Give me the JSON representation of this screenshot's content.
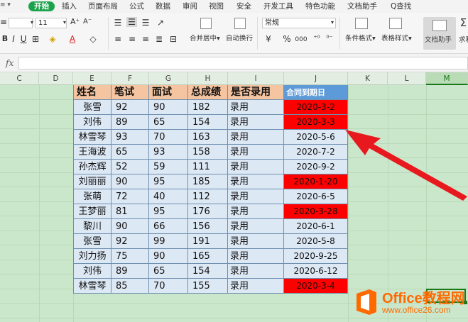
{
  "menu": {
    "dropdown": "≡ ▾",
    "items": [
      "开始",
      "插入",
      "页面布局",
      "公式",
      "数据",
      "审阅",
      "视图",
      "安全",
      "开发工具",
      "特色功能",
      "文档助手",
      "Q查找"
    ],
    "active_index": 0
  },
  "toolbar": {
    "font_size": "11",
    "bold": "B",
    "italic": "I",
    "underline": "U",
    "merge_label": "合并居中▾",
    "wrap_label": "自动换行",
    "number_format": "常规",
    "currency": "¥",
    "percent": "%",
    "thousands": "000",
    "cond_format_label": "条件格式▾",
    "table_style_label": "表格样式▾",
    "doc_helper_label": "文档助手",
    "sum_label": "求和"
  },
  "formula_bar": {
    "fx": "fx",
    "value": ""
  },
  "columns": [
    "C",
    "D",
    "E",
    "F",
    "G",
    "H",
    "I",
    "J",
    "K",
    "L",
    "M"
  ],
  "selected_column": "M",
  "table": {
    "headers": [
      "姓名",
      "笔试",
      "面试",
      "总成绩",
      "是否录用",
      "合同到期日"
    ],
    "rows": [
      {
        "name": "张雪",
        "written": "92",
        "interview": "90",
        "total": "182",
        "hired": "录用",
        "date": "2020-3-2",
        "expired": true
      },
      {
        "name": "刘伟",
        "written": "89",
        "interview": "65",
        "total": "154",
        "hired": "录用",
        "date": "2020-3-3",
        "expired": true
      },
      {
        "name": "林雪琴",
        "written": "93",
        "interview": "70",
        "total": "163",
        "hired": "录用",
        "date": "2020-5-6",
        "expired": false
      },
      {
        "name": "王海波",
        "written": "65",
        "interview": "93",
        "total": "158",
        "hired": "录用",
        "date": "2020-7-2",
        "expired": false
      },
      {
        "name": "孙杰辉",
        "written": "52",
        "interview": "59",
        "total": "111",
        "hired": "录用",
        "date": "2020-9-2",
        "expired": false
      },
      {
        "name": "刘丽丽",
        "written": "90",
        "interview": "95",
        "total": "185",
        "hired": "录用",
        "date": "2020-1-20",
        "expired": true
      },
      {
        "name": "张萌",
        "written": "72",
        "interview": "40",
        "total": "112",
        "hired": "录用",
        "date": "2020-6-5",
        "expired": false
      },
      {
        "name": "王梦丽",
        "written": "81",
        "interview": "95",
        "total": "176",
        "hired": "录用",
        "date": "2020-3-28",
        "expired": true
      },
      {
        "name": "黎川",
        "written": "90",
        "interview": "66",
        "total": "156",
        "hired": "录用",
        "date": "2020-6-1",
        "expired": false
      },
      {
        "name": "张雪",
        "written": "92",
        "interview": "99",
        "total": "191",
        "hired": "录用",
        "date": "2020-5-8",
        "expired": false
      },
      {
        "name": "刘力扬",
        "written": "75",
        "interview": "90",
        "total": "165",
        "hired": "录用",
        "date": "2020-9-25",
        "expired": false
      },
      {
        "name": "刘伟",
        "written": "89",
        "interview": "65",
        "total": "154",
        "hired": "录用",
        "date": "2020-6-12",
        "expired": false
      },
      {
        "name": "林雪琴",
        "written": "85",
        "interview": "70",
        "total": "155",
        "hired": "录用",
        "date": "2020-3-4",
        "expired": true
      }
    ]
  },
  "colors": {
    "accent": "#1aa34a",
    "header_fill": "#f5c4a0",
    "date_header_fill": "#5c9ad8",
    "row_fill": "#dde8f5",
    "highlight_red": "#ff0000",
    "sheet_bg": "#cbe7cb",
    "arrow": "#e8191e"
  },
  "watermark": {
    "title": "Office教程网",
    "url": "www.office26.com"
  }
}
